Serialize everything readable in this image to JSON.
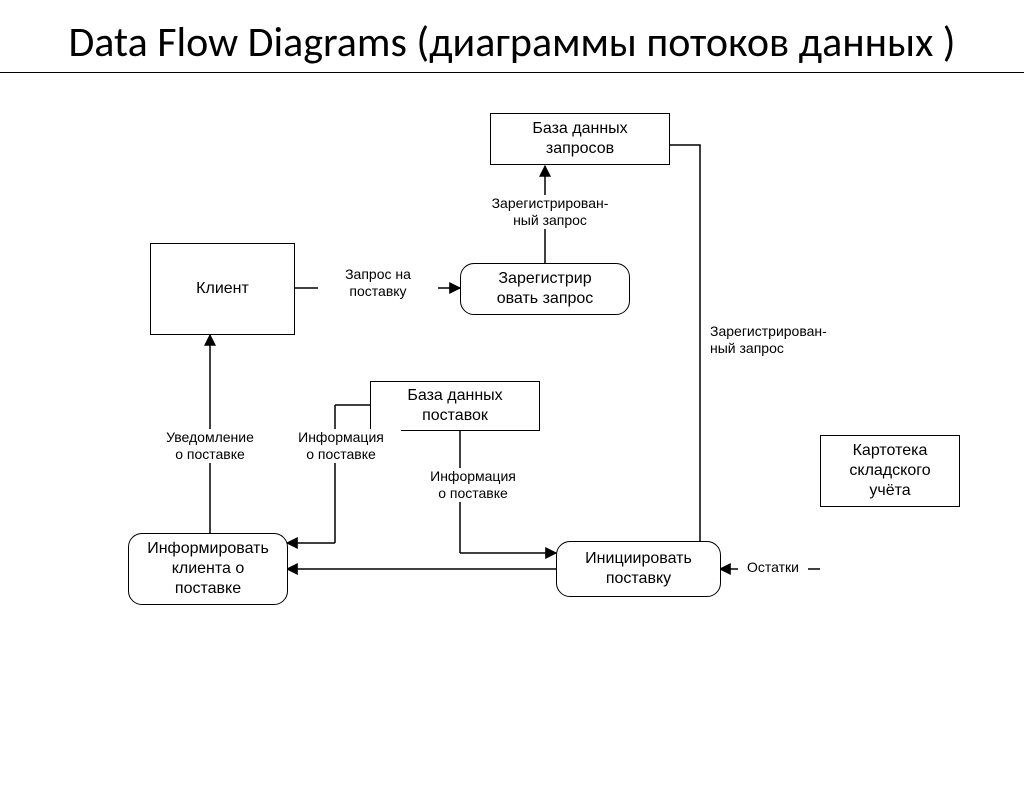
{
  "title": "Data Flow Diagrams (диаграммы потоков данных )",
  "nodes": {
    "client": {
      "label": "Клиент"
    },
    "register_request": {
      "label": "Зарегистрир\nовать запрос"
    },
    "requests_db": {
      "label": "База данных\nзапросов"
    },
    "supplies_db": {
      "label": "База данных\nпоставок"
    },
    "inform_client": {
      "label": "Информировать\nклиента о\nпоставке"
    },
    "initiate_supply": {
      "label": "Инициировать\nпоставку"
    },
    "warehouse_card": {
      "label": "Картотека\nскладского\nучёта"
    }
  },
  "edges": {
    "client_to_register": {
      "label": "Запрос на\nпоставку"
    },
    "register_to_db": {
      "label": "Зарегистрирован-\nный запрос"
    },
    "db_to_initiate": {
      "label": "Зарегистрирован-\nный запрос"
    },
    "supplies_to_initiate": {
      "label": "Информация\nо поставке"
    },
    "supplies_to_inform": {
      "label": "Информация\nо поставке"
    },
    "inform_to_client": {
      "label": "Уведомление\nо поставке"
    },
    "initiate_to_inform": {
      "label": ""
    },
    "warehouse_to_initiate": {
      "label": "Остатки"
    }
  }
}
